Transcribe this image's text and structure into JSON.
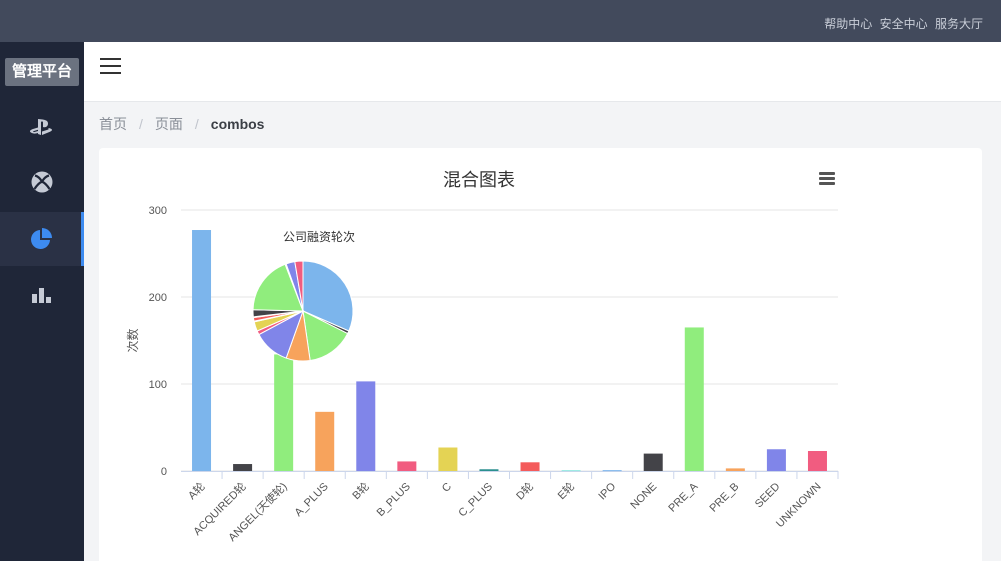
{
  "topbar": {
    "links": [
      "帮助中心",
      "安全中心",
      "服务大厅"
    ]
  },
  "sidebar": {
    "logo": "管理平台",
    "items": [
      {
        "icon": "playstation-icon",
        "active": false
      },
      {
        "icon": "xbox-icon",
        "active": false
      },
      {
        "icon": "pie-chart-icon",
        "active": true
      },
      {
        "icon": "bar-chart-icon",
        "active": false
      }
    ]
  },
  "breadcrumb": {
    "items": [
      "首页",
      "页面"
    ],
    "current": "combos"
  },
  "colors": {
    "accent": "#3d8bf0",
    "sidebar": "#1f2638",
    "topbar": "#424a5c"
  },
  "chart_data": [
    {
      "type": "bar",
      "title": "混合图表",
      "ylabel": "次数",
      "ylim": [
        0,
        300
      ],
      "yticks": [
        0,
        100,
        200,
        300
      ],
      "grid": true,
      "categories": [
        "A轮",
        "ACQUIRED轮",
        "ANGEL(天使轮)",
        "A_PLUS",
        "B轮",
        "B_PLUS",
        "C",
        "C_PLUS",
        "D轮",
        "E轮",
        "IPO",
        "NONE",
        "PRE_A",
        "PRE_B",
        "SEED",
        "UNKNOWN"
      ],
      "values": [
        277,
        8,
        134,
        68,
        103,
        11,
        27,
        2,
        10,
        1,
        1,
        20,
        165,
        3,
        25,
        23
      ],
      "colors": [
        "#7cb5ec",
        "#434348",
        "#90ed7d",
        "#f7a35c",
        "#8085e9",
        "#f15c80",
        "#e4d354",
        "#2b908f",
        "#f45b5b",
        "#91e8e1",
        "#7cb5ec",
        "#434348",
        "#90ed7d",
        "#f7a35c",
        "#8085e9",
        "#f15c80"
      ]
    },
    {
      "type": "pie",
      "title": "公司融资轮次",
      "categories": [
        "A轮",
        "ACQUIRED轮",
        "ANGEL(天使轮)",
        "A_PLUS",
        "B轮",
        "B_PLUS",
        "C",
        "C_PLUS",
        "D轮",
        "E轮",
        "IPO",
        "NONE",
        "PRE_A",
        "PRE_B",
        "SEED",
        "UNKNOWN"
      ],
      "values": [
        277,
        8,
        134,
        68,
        103,
        11,
        27,
        2,
        10,
        1,
        1,
        20,
        165,
        3,
        25,
        23
      ]
    }
  ]
}
